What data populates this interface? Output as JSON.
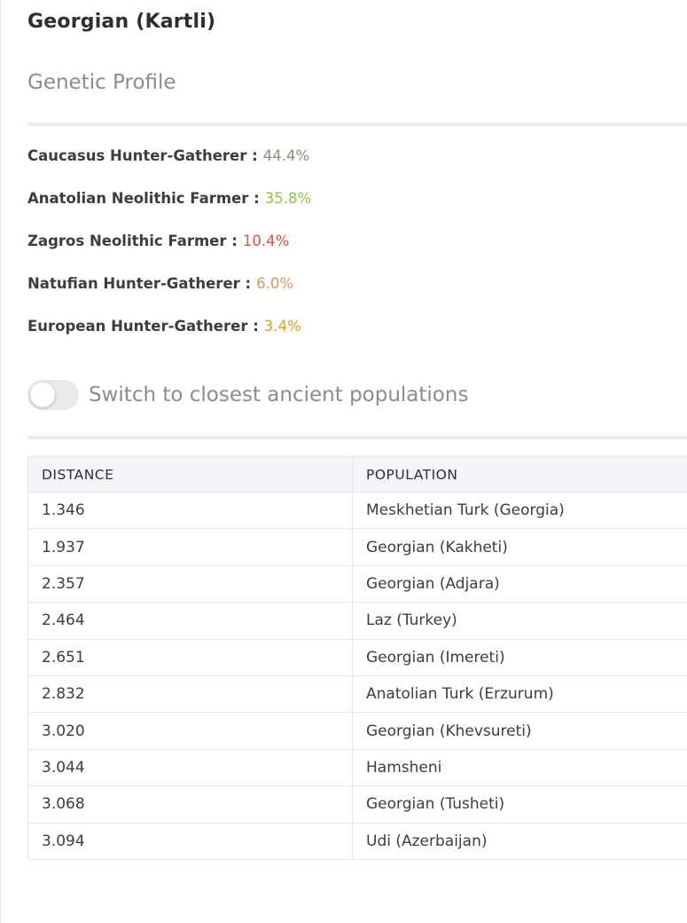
{
  "header": {
    "title": "Georgian (Kartli)",
    "subtitle": "Genetic Profile"
  },
  "composition": [
    {
      "label": "Caucasus Hunter-Gatherer :",
      "value": "44.4%",
      "color": "#8a8f7e"
    },
    {
      "label": "Anatolian Neolithic Farmer :",
      "value": "35.8%",
      "color": "#8cc63f"
    },
    {
      "label": "Zagros Neolithic Farmer :",
      "value": "10.4%",
      "color": "#e0504b"
    },
    {
      "label": "Natufian Hunter-Gatherer :",
      "value": "6.0%",
      "color": "#d39a55"
    },
    {
      "label": "European Hunter-Gatherer :",
      "value": "3.4%",
      "color": "#e59a1f"
    }
  ],
  "toggle": {
    "label": "Switch to closest ancient populations",
    "on": false
  },
  "table": {
    "headers": [
      "DISTANCE",
      "POPULATION"
    ],
    "rows": [
      {
        "distance": "1.346",
        "population": "Meskhetian Turk (Georgia)",
        "tone": "green"
      },
      {
        "distance": "1.937",
        "population": "Georgian (Kakheti)",
        "tone": "green"
      },
      {
        "distance": "2.357",
        "population": "Georgian (Adjara)",
        "tone": "green"
      },
      {
        "distance": "2.464",
        "population": "Laz (Turkey)",
        "tone": "green"
      },
      {
        "distance": "2.651",
        "population": "Georgian (Imereti)",
        "tone": "green"
      },
      {
        "distance": "2.832",
        "population": "Anatolian Turk (Erzurum)",
        "tone": "green"
      },
      {
        "distance": "3.020",
        "population": "Georgian (Khevsureti)",
        "tone": "orange"
      },
      {
        "distance": "3.044",
        "population": "Hamsheni",
        "tone": "orange"
      },
      {
        "distance": "3.068",
        "population": "Georgian (Tusheti)",
        "tone": "orange"
      },
      {
        "distance": "3.094",
        "population": "Udi (Azerbaijan)",
        "tone": "orange"
      }
    ]
  }
}
